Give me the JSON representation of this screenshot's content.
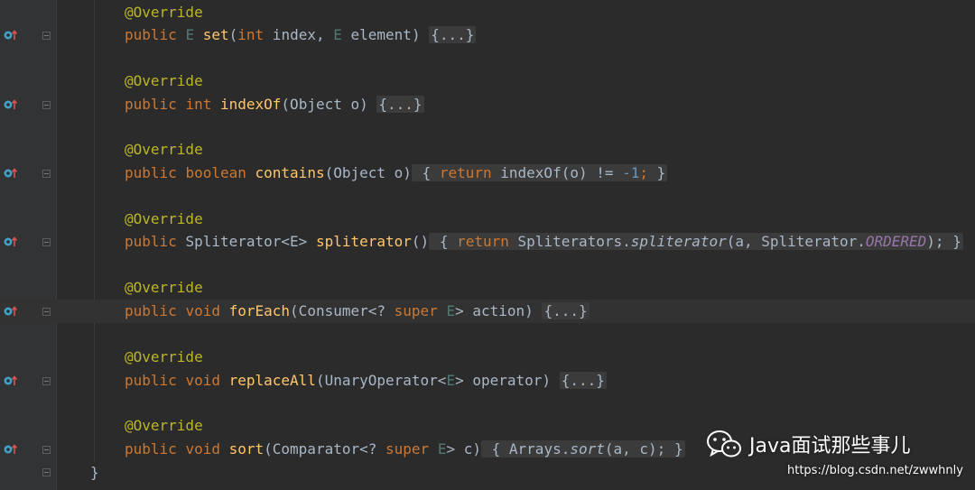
{
  "editor": {
    "annotation": "@Override",
    "methods": [
      {
        "modifier": "public",
        "return_type": "E",
        "name": "set",
        "params": "(int index, E element)",
        "body": "{...}"
      },
      {
        "modifier": "public",
        "return_type": "int",
        "name": "indexOf",
        "params": "(Object o)",
        "body": "{...}"
      },
      {
        "modifier": "public",
        "return_type": "boolean",
        "name": "contains",
        "params": "(Object o)",
        "body_open": "{",
        "body_return": "return",
        "body_expr": "indexOf(o) != ",
        "body_num": "-1",
        "body_close": "}"
      },
      {
        "modifier": "public",
        "return_type": "Spliterator<E>",
        "name": "spliterator",
        "params": "()",
        "body_open": "{",
        "body_return": "return",
        "body_class": "Spliterators.",
        "body_method": "spliterator",
        "body_args_a": "(a, Spliterator.",
        "body_const": "ORDERED",
        "body_args_end": ");",
        "body_close": "}"
      },
      {
        "modifier": "public",
        "return_type": "void",
        "name": "forEach",
        "params": "(Consumer<? super E> action)",
        "body": "{...}"
      },
      {
        "modifier": "public",
        "return_type": "void",
        "name": "replaceAll",
        "params": "(UnaryOperator<E> operator)",
        "body": "{...}"
      },
      {
        "modifier": "public",
        "return_type": "void",
        "name": "sort",
        "params": "(Comparator<? super E> c)",
        "body_open": "{",
        "body_class": "Arrays.",
        "body_method": "sort",
        "body_args": "(a, c);",
        "body_close": "}"
      }
    ],
    "closing_brace": "}"
  },
  "watermark": {
    "title": "Java面试那些事儿",
    "url": "https://blog.csdn.net/zwwhnly"
  },
  "colors": {
    "background": "#2b2b2b",
    "keyword": "#cc7832",
    "annotation": "#bbb529",
    "method": "#ffc66d",
    "text": "#a9b7c6"
  },
  "icons": {
    "gutter": "override-method-icon",
    "fold": "fold-marker-icon"
  }
}
